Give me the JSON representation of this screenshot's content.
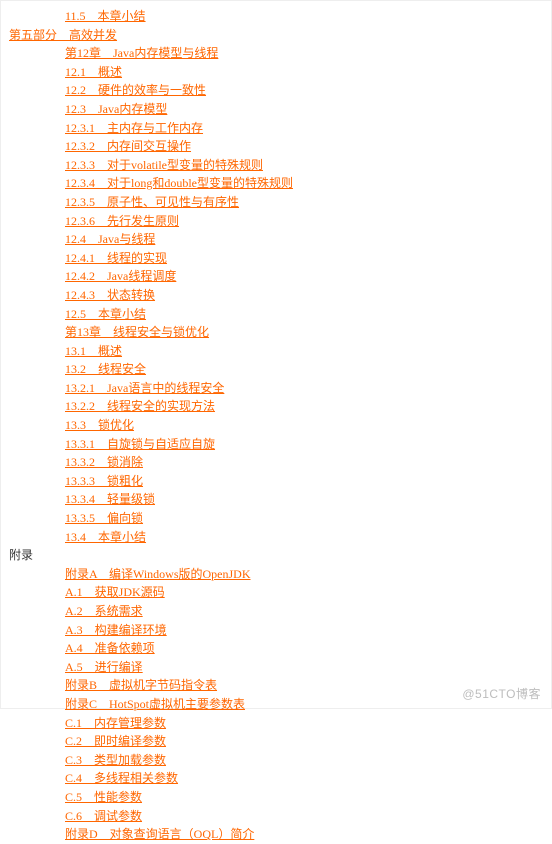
{
  "watermark": "@51CTO博客",
  "toc": [
    {
      "level": 2,
      "text": "11.5　本章小结",
      "link": true
    },
    {
      "level": 0,
      "text": "第五部分　高效并发",
      "link": true
    },
    {
      "level": 2,
      "text": "第12章　Java内存模型与线程",
      "link": true
    },
    {
      "level": 2,
      "text": "12.1　概述",
      "link": true
    },
    {
      "level": 2,
      "text": "12.2　硬件的效率与一致性",
      "link": true
    },
    {
      "level": 2,
      "text": "12.3　Java内存模型",
      "link": true
    },
    {
      "level": 2,
      "text": "12.3.1　主内存与工作内存",
      "link": true
    },
    {
      "level": 2,
      "text": "12.3.2　内存间交互操作",
      "link": true
    },
    {
      "level": 2,
      "text": "12.3.3　对于volatile型变量的特殊规则",
      "link": true
    },
    {
      "level": 2,
      "text": "12.3.4　对于long和double型变量的特殊规则",
      "link": true
    },
    {
      "level": 2,
      "text": "12.3.5　原子性、可见性与有序性",
      "link": true
    },
    {
      "level": 2,
      "text": "12.3.6　先行发生原则",
      "link": true
    },
    {
      "level": 2,
      "text": "12.4　Java与线程",
      "link": true
    },
    {
      "level": 2,
      "text": "12.4.1　线程的实现",
      "link": true
    },
    {
      "level": 2,
      "text": "12.4.2　Java线程调度",
      "link": true
    },
    {
      "level": 2,
      "text": "12.4.3　状态转换",
      "link": true
    },
    {
      "level": 2,
      "text": "12.5　本章小结",
      "link": true
    },
    {
      "level": 2,
      "text": "第13章　线程安全与锁优化",
      "link": true
    },
    {
      "level": 2,
      "text": "13.1　概述",
      "link": true
    },
    {
      "level": 2,
      "text": "13.2　线程安全",
      "link": true
    },
    {
      "level": 2,
      "text": "13.2.1　Java语言中的线程安全",
      "link": true
    },
    {
      "level": 2,
      "text": "13.2.2　线程安全的实现方法",
      "link": true
    },
    {
      "level": 2,
      "text": "13.3　锁优化",
      "link": true
    },
    {
      "level": 2,
      "text": "13.3.1　自旋锁与自适应自旋",
      "link": true
    },
    {
      "level": 2,
      "text": "13.3.2　锁消除",
      "link": true
    },
    {
      "level": 2,
      "text": "13.3.3　锁粗化",
      "link": true
    },
    {
      "level": 2,
      "text": "13.3.4　轻量级锁",
      "link": true
    },
    {
      "level": 2,
      "text": "13.3.5　偏向锁",
      "link": true
    },
    {
      "level": 2,
      "text": "13.4　本章小结",
      "link": true
    },
    {
      "level": 0,
      "text": "附录",
      "link": false
    },
    {
      "level": 2,
      "text": "附录A　编译Windows版的OpenJDK",
      "link": true
    },
    {
      "level": 2,
      "text": "A.1　获取JDK源码",
      "link": true
    },
    {
      "level": 2,
      "text": "A.2　系统需求",
      "link": true
    },
    {
      "level": 2,
      "text": "A.3　构建编译环境",
      "link": true
    },
    {
      "level": 2,
      "text": "A.4　准备依赖项",
      "link": true
    },
    {
      "level": 2,
      "text": "A.5　进行编译",
      "link": true
    },
    {
      "level": 2,
      "text": "附录B　虚拟机字节码指令表",
      "link": true
    },
    {
      "level": 2,
      "text": "附录C　HotSpot虚拟机主要参数表",
      "link": true
    },
    {
      "level": 2,
      "text": "C.1　内存管理参数",
      "link": true
    },
    {
      "level": 2,
      "text": "C.2　即时编译参数",
      "link": true
    },
    {
      "level": 2,
      "text": "C.3　类型加载参数",
      "link": true
    },
    {
      "level": 2,
      "text": "C.4　多线程相关参数",
      "link": true
    },
    {
      "level": 2,
      "text": "C.5　性能参数",
      "link": true
    },
    {
      "level": 2,
      "text": "C.6　调试参数",
      "link": true
    },
    {
      "level": 2,
      "text": "附录D　对象查询语言（OQL）简介",
      "link": true
    }
  ]
}
